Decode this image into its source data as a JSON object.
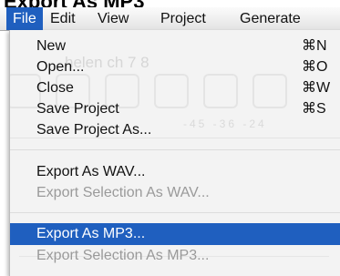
{
  "heading": "Export As MP3",
  "menubar": {
    "items": [
      "File",
      "Edit",
      "View",
      "Project",
      "Generate"
    ]
  },
  "background_window": {
    "title": "helen ch 7 8",
    "scale_text": "-45 -36 -24"
  },
  "file_menu": {
    "items": [
      {
        "label": "New",
        "shortcut": "⌘N",
        "state": "enabled"
      },
      {
        "label": "Open...",
        "shortcut": "⌘O",
        "state": "enabled"
      },
      {
        "label": "Close",
        "shortcut": "⌘W",
        "state": "enabled"
      },
      {
        "label": "Save Project",
        "shortcut": "⌘S",
        "state": "enabled"
      },
      {
        "label": "Save Project As...",
        "shortcut": "",
        "state": "enabled"
      },
      {
        "label": "Export As WAV...",
        "shortcut": "",
        "state": "enabled"
      },
      {
        "label": "Export Selection As WAV...",
        "shortcut": "",
        "state": "disabled"
      },
      {
        "label": "Export As MP3...",
        "shortcut": "",
        "state": "selected"
      },
      {
        "label": "Export Selection As MP3...",
        "shortcut": "",
        "state": "disabled"
      }
    ]
  },
  "colors": {
    "selection": "#1f5fbf",
    "menu_background": "#f3f3f3",
    "disabled_text": "#9a9a9a"
  }
}
